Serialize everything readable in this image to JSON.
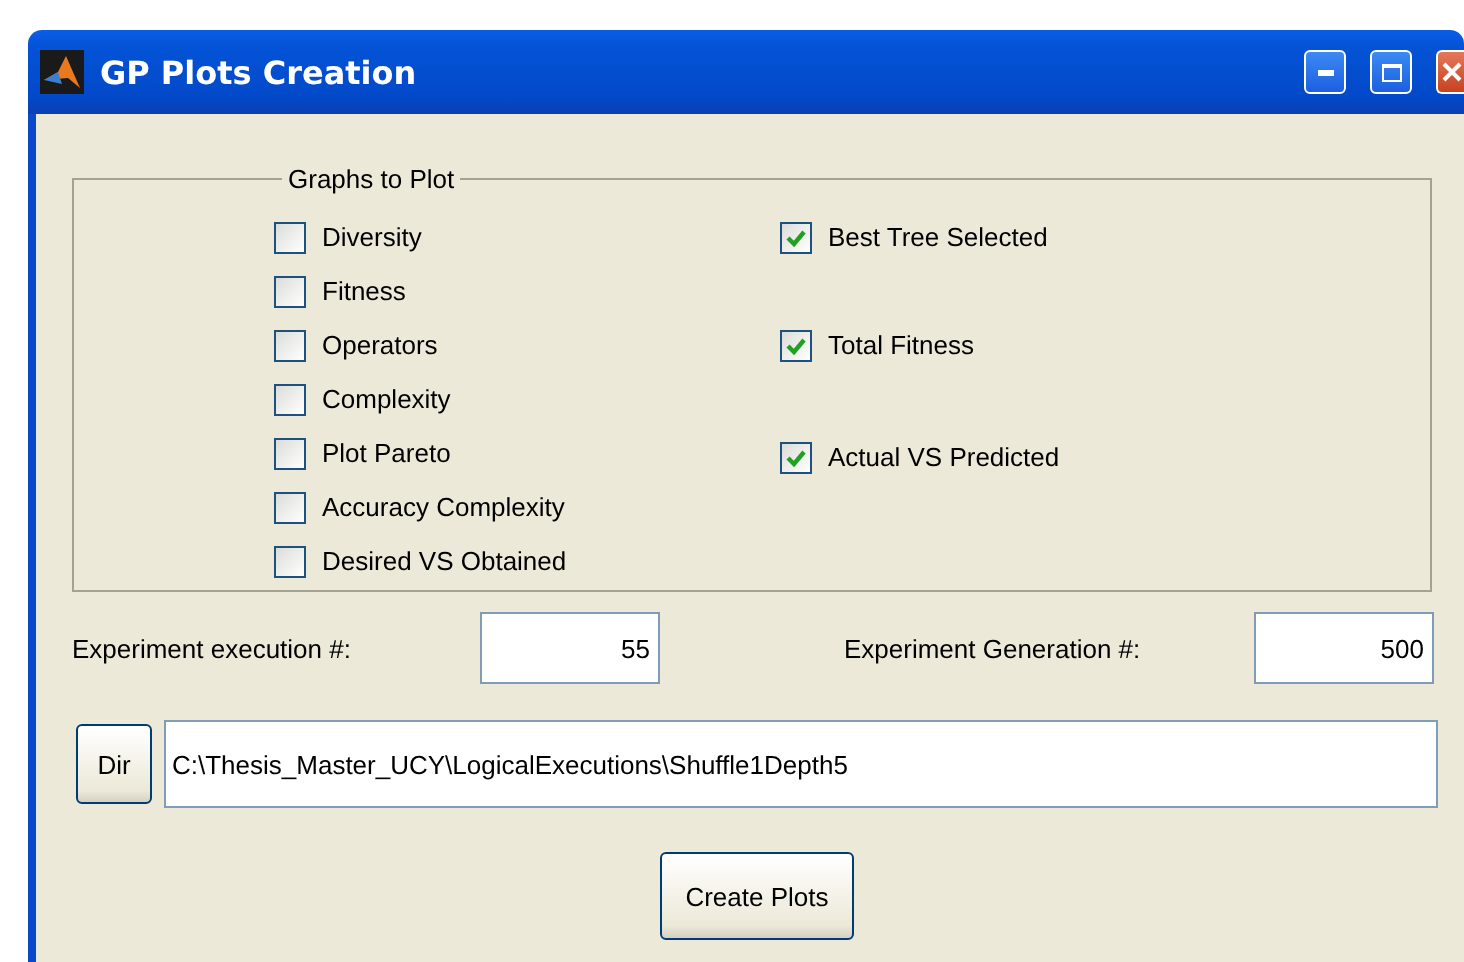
{
  "window": {
    "title": "GP Plots Creation"
  },
  "graphs_group": {
    "title": "Graphs to Plot",
    "left": [
      {
        "label": "Diversity",
        "checked": false
      },
      {
        "label": "Fitness",
        "checked": false
      },
      {
        "label": "Operators",
        "checked": false
      },
      {
        "label": "Complexity",
        "checked": false
      },
      {
        "label": "Plot Pareto",
        "checked": false
      },
      {
        "label": "Accuracy Complexity",
        "checked": false
      },
      {
        "label": "Desired VS Obtained",
        "checked": false
      }
    ],
    "right": [
      {
        "label": "Best Tree Selected",
        "checked": true
      },
      {
        "label": "Total Fitness",
        "checked": true
      },
      {
        "label": "Actual VS Predicted",
        "checked": true
      }
    ]
  },
  "execution": {
    "label": "Experiment execution #:",
    "value": "55"
  },
  "generation": {
    "label": "Experiment Generation #:",
    "value": "500"
  },
  "dir_button": "Dir",
  "path": {
    "value": "C:\\Thesis_Master_UCY\\LogicalExecutions\\Shuffle1Depth5"
  },
  "create_button": "Create Plots"
}
